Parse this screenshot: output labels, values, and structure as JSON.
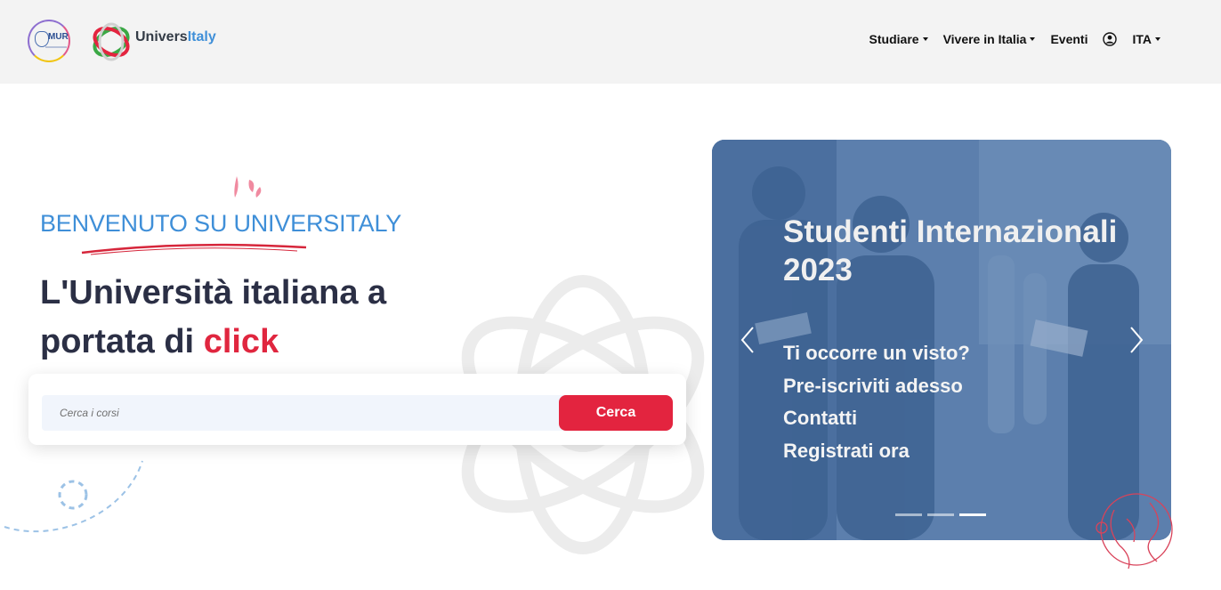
{
  "header": {
    "mur_logo_text": "MUR",
    "brand_part1": "Univers",
    "brand_part2": "Italy",
    "nav": [
      {
        "label": "Studiare",
        "icon": "caret-down-icon"
      },
      {
        "label": "Vivere in Italia",
        "icon": "caret-down-icon"
      },
      {
        "label": "Eventi"
      },
      {
        "icon": "user-circle-icon"
      },
      {
        "label": "ITA",
        "icon": "caret-down-icon"
      }
    ]
  },
  "hero": {
    "welcome": "BENVENUTO SU UNIVERSITALY",
    "headline_line1": "L'Università italiana a",
    "headline_line2_prefix": "portata di ",
    "headline_accent": "click"
  },
  "search": {
    "placeholder": "Cerca i corsi",
    "button_label": "Cerca"
  },
  "carousel": {
    "title": "Studenti Internazionali 2023",
    "links": [
      "Ti occorre un visto?",
      "Pre-iscriviti adesso",
      "Contatti",
      "Registrati ora"
    ],
    "indicator_count": 3,
    "active_index": 2,
    "prev_icon": "chevron-left-icon",
    "next_icon": "chevron-right-icon"
  },
  "colors": {
    "accent_red": "#e3243f",
    "brand_blue": "#3f8fd8",
    "header_bg": "#f3f3f3",
    "headline": "#2b2f45"
  }
}
